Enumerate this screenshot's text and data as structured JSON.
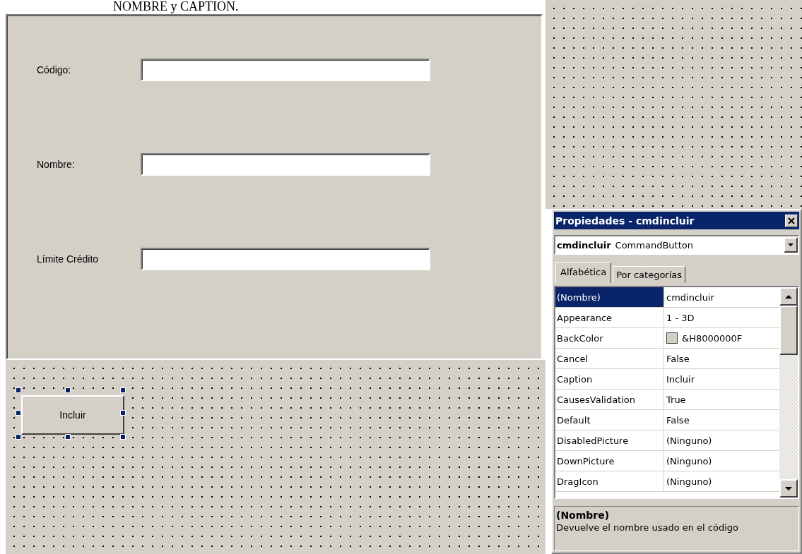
{
  "heading": "NOMBRE y CAPTION.",
  "form": {
    "fields": [
      {
        "label": "Código:"
      },
      {
        "label": "Nombre:"
      },
      {
        "label": "Límite Crédito"
      }
    ],
    "button": {
      "caption": "Incluir",
      "selected": true
    }
  },
  "properties": {
    "title": "Propiedades - cmdincluir",
    "object": {
      "name": "cmdincluir",
      "type": "CommandButton"
    },
    "tabs": [
      {
        "label": "Alfabética",
        "selected": true
      },
      {
        "label": "Por categorías",
        "selected": false
      }
    ],
    "rows": [
      {
        "name": "(Nombre)",
        "value": "cmdincluir",
        "selected": true,
        "kind": "text"
      },
      {
        "name": "Appearance",
        "value": "1 - 3D",
        "selected": false,
        "kind": "text"
      },
      {
        "name": "BackColor",
        "value": "&H8000000F",
        "selected": false,
        "kind": "color"
      },
      {
        "name": "Cancel",
        "value": "False",
        "selected": false,
        "kind": "text"
      },
      {
        "name": "Caption",
        "value": "Incluir",
        "selected": false,
        "kind": "text"
      },
      {
        "name": "CausesValidation",
        "value": "True",
        "selected": false,
        "kind": "text"
      },
      {
        "name": "Default",
        "value": "False",
        "selected": false,
        "kind": "text"
      },
      {
        "name": "DisabledPicture",
        "value": "(Ninguno)",
        "selected": false,
        "kind": "text"
      },
      {
        "name": "DownPicture",
        "value": "(Ninguno)",
        "selected": false,
        "kind": "text"
      },
      {
        "name": "DragIcon",
        "value": "(Ninguno)",
        "selected": false,
        "kind": "text"
      }
    ],
    "description": {
      "title": "(Nombre)",
      "text": "Devuelve el nombre usado en el código"
    }
  }
}
